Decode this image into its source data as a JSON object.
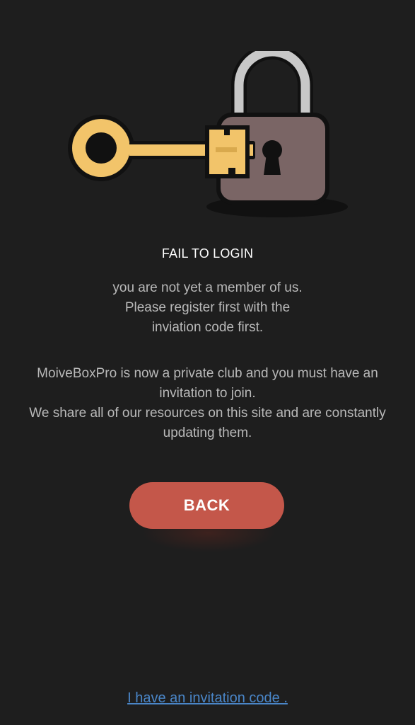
{
  "illustration": {
    "icon": "key-and-padlock-icon",
    "colors": {
      "key": "#f2c46a",
      "lock_body": "#7a6565",
      "shackle": "#c8c8c8",
      "outline": "#111111"
    }
  },
  "status": {
    "title": "FAIL TO LOGIN",
    "notice_lines": [
      "you are not yet a member of us.",
      "Please register first with the",
      "inviation code first."
    ],
    "info_lines": [
      "MoiveBoxPro is now a private club and you must have an",
      "invitation to join.",
      "We share all of our resources on this site and are constantly",
      "updating them."
    ]
  },
  "actions": {
    "back_label": "BACK",
    "invite_link": "I have an invitation code ."
  },
  "theme": {
    "background": "#1e1e1e",
    "accent": "#c4574a",
    "link": "#4a86c8"
  }
}
